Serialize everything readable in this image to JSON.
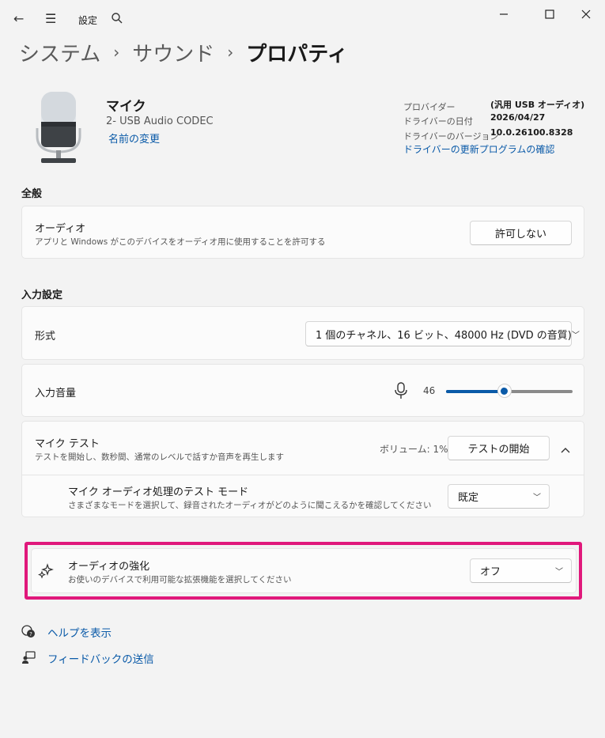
{
  "titlebar": {
    "title": "設定",
    "back_icon": "←",
    "menu_icon": "☰",
    "search_icon": "⌕",
    "minimize": "—",
    "maximize": "☐",
    "close": "✕"
  },
  "breadcrumb": {
    "items": [
      "システム",
      "サウンド",
      "プロパティ"
    ],
    "separator": "›"
  },
  "device": {
    "name": "マイク",
    "subtitle": "2- USB Audio CODEC",
    "rename_link": "名前の変更",
    "info": [
      {
        "key": "プロバイダー",
        "value": "(汎用 USB オーディオ)"
      },
      {
        "key": "ドライバーの日付",
        "value": "2026/04/27"
      },
      {
        "key": "ドライバーのバージョン",
        "value": "10.0.26100.8328"
      }
    ],
    "driver_update_link": "ドライバーの更新プログラムの確認"
  },
  "general": {
    "section_title": "全般",
    "audio": {
      "title": "オーディオ",
      "desc": "アプリと Windows がこのデバイスをオーディオ用に使用することを許可する",
      "button": "許可しない"
    }
  },
  "input_settings": {
    "section_title": "入力設定",
    "format": {
      "title": "形式",
      "value": "1 個のチャネル、16 ビット、48000 Hz (DVD の音質)"
    },
    "volume": {
      "title": "入力音量",
      "value": "46",
      "level": 46
    },
    "mic_test": {
      "title": "マイク テスト",
      "desc": "テストを開始し、数秒間、通常のレベルで話すか音声を再生します",
      "volume_text": "ボリューム: 1%",
      "button": "テストの開始"
    },
    "test_mode": {
      "title": "マイク オーディオ処理のテスト モード",
      "desc": "さまざまなモードを選択して、録音されたオーディオがどのように聞こえるかを確認してください",
      "value": "既定"
    }
  },
  "enhancement": {
    "title": "オーディオの強化",
    "desc": "お使いのデバイスで利用可能な拡張機能を選択してください",
    "value": "オフ"
  },
  "footer": {
    "help": "ヘルプを表示",
    "feedback": "フィードバックの送信"
  },
  "colors": {
    "accent": "#0a5aa8",
    "highlight": "#e0187b",
    "background": "#f3f3f3"
  }
}
